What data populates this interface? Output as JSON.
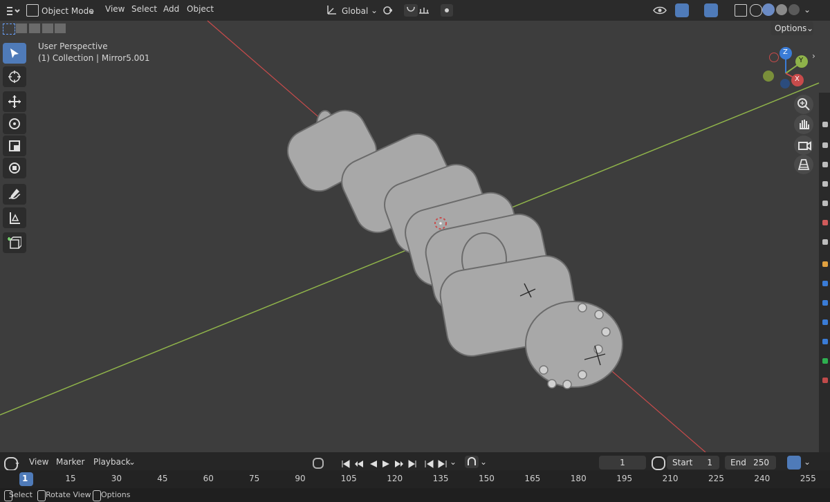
{
  "header": {
    "mode": "Object Mode",
    "menus": [
      "View",
      "Select",
      "Add",
      "Object"
    ],
    "orientation": "Global",
    "options": "Options"
  },
  "viewport": {
    "perspective_label": "User Perspective",
    "collection_label": "(1) Collection | Mirror5.001"
  },
  "gizmo": {
    "z": "Z",
    "y": "Y",
    "x": "X"
  },
  "timeline": {
    "menus": [
      "View",
      "Marker",
      "Playback"
    ],
    "current_frame": "1",
    "start_label": "Start",
    "start_value": "1",
    "end_label": "End",
    "end_value": "250",
    "ticks": [
      "1",
      "15",
      "30",
      "45",
      "60",
      "75",
      "90",
      "105",
      "120",
      "135",
      "150",
      "165",
      "180",
      "195",
      "210",
      "225",
      "240",
      "255"
    ]
  },
  "status": {
    "select": "Select",
    "rotate_view": "Rotate View",
    "options": "Options"
  },
  "colors": {
    "accent": "#4f7bb9",
    "x_axis": "#c84b4b",
    "y_axis": "#8fb34a",
    "z_axis": "#3a7cd7"
  }
}
